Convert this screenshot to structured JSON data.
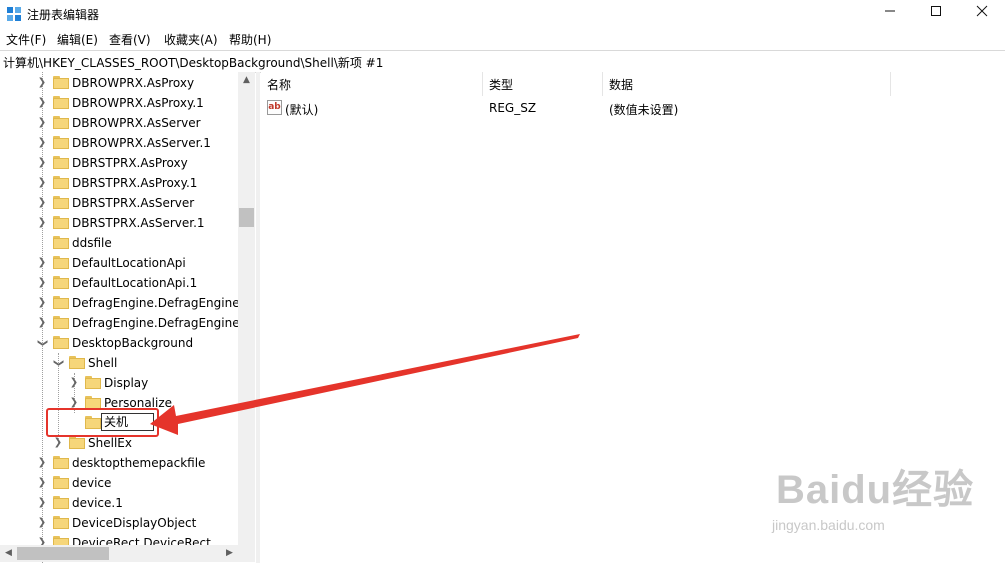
{
  "window": {
    "title": "注册表编辑器"
  },
  "menu": [
    "文件(F)",
    "编辑(E)",
    "查看(V)",
    "收藏夹(A)",
    "帮助(H)"
  ],
  "address": "计算机\\HKEY_CLASSES_ROOT\\DesktopBackground\\Shell\\新项 #1",
  "tree": {
    "items": [
      "DBROWPRX.AsProxy",
      "DBROWPRX.AsProxy.1",
      "DBROWPRX.AsServer",
      "DBROWPRX.AsServer.1",
      "DBRSTPRX.AsProxy",
      "DBRSTPRX.AsProxy.1",
      "DBRSTPRX.AsServer",
      "DBRSTPRX.AsServer.1",
      "ddsfile",
      "DefaultLocationApi",
      "DefaultLocationApi.1",
      "DefragEngine.DefragEngine",
      "DefragEngine.DefragEngine.",
      "DesktopBackground",
      "Shell",
      "Display",
      "Personalize",
      "",
      "ShellEx",
      "desktopthemepackfile",
      "device",
      "device.1",
      "DeviceDisplayObject",
      "DeviceRect.DeviceRect"
    ],
    "rename_value": "关机"
  },
  "columns": {
    "name": "名称",
    "type": "类型",
    "data": "数据"
  },
  "values": [
    {
      "name": "(默认)",
      "type": "REG_SZ",
      "data": "(数值未设置)"
    }
  ],
  "icons": {
    "value_icon": "ab"
  },
  "watermark": {
    "brand": "Baidu经验",
    "site": "jingyan.baidu.com"
  },
  "colors": {
    "annotation": "#e5342b",
    "folder": "#f6d67a"
  }
}
